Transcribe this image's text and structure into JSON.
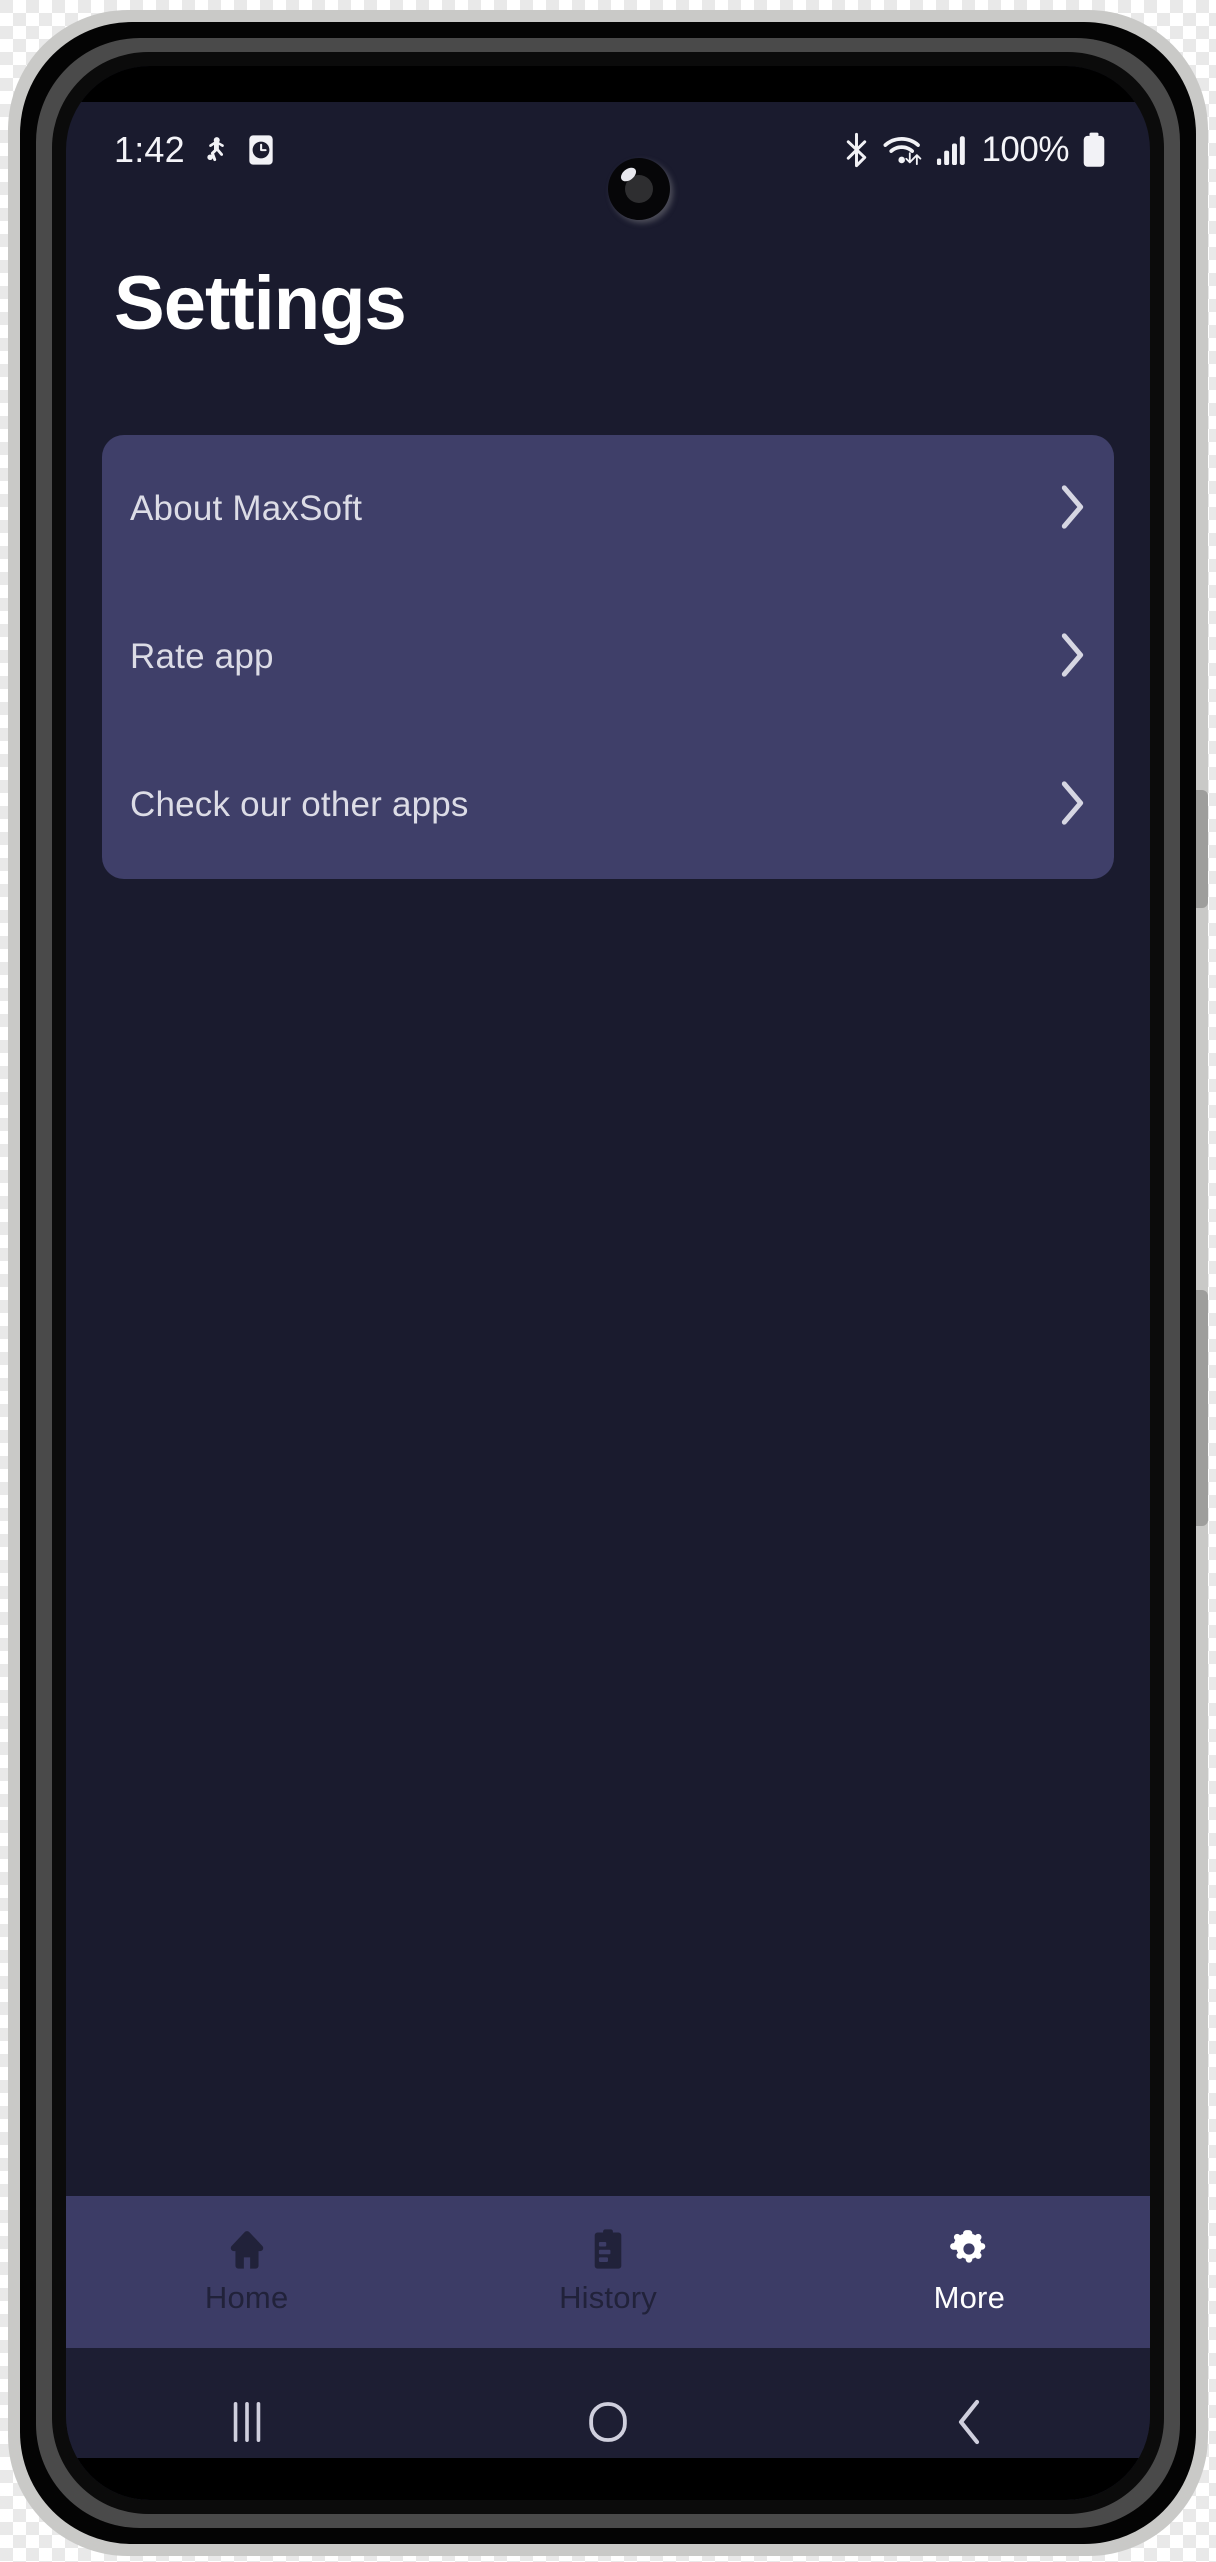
{
  "device": {
    "frame_color": "#c9c9c7",
    "screen_bg": "#1a1b2e"
  },
  "status_bar": {
    "time": "1:42",
    "left_icons": [
      {
        "name": "accessibility-icon",
        "label": "Accessibility"
      },
      {
        "name": "alarm-clock-icon",
        "label": "Alarm"
      }
    ],
    "right_icons": [
      {
        "name": "bluetooth-icon",
        "label": "Bluetooth"
      },
      {
        "name": "wifi-icon",
        "label": "Wi-Fi"
      },
      {
        "name": "cellular-signal-icon",
        "label": "Signal"
      }
    ],
    "battery_percent": "100%",
    "battery_icon": "battery-full-icon"
  },
  "header": {
    "title": "Settings"
  },
  "settings_card": {
    "background": "#3f3f69",
    "rows": [
      {
        "label": "About MaxSoft",
        "icon": "chevron-right-icon",
        "name": "about-maxsoft"
      },
      {
        "label": "Rate app",
        "icon": "chevron-right-icon",
        "name": "rate-app"
      },
      {
        "label": "Check our other apps",
        "icon": "chevron-right-icon",
        "name": "check-other-apps"
      }
    ]
  },
  "tab_bar": {
    "background": "#3c3c66",
    "active_color": "#ffffff",
    "inactive_color": "#21223a",
    "tabs": [
      {
        "label": "Home",
        "icon": "home-icon",
        "active": false
      },
      {
        "label": "History",
        "icon": "clipboard-icon",
        "active": false
      },
      {
        "label": "More",
        "icon": "gear-icon",
        "active": true
      }
    ]
  },
  "system_nav": {
    "background": "#1d1e33",
    "buttons": [
      {
        "name": "recents-button",
        "icon": "recents-icon"
      },
      {
        "name": "home-button",
        "icon": "home-circle-icon"
      },
      {
        "name": "back-button",
        "icon": "back-chevron-icon"
      }
    ]
  }
}
